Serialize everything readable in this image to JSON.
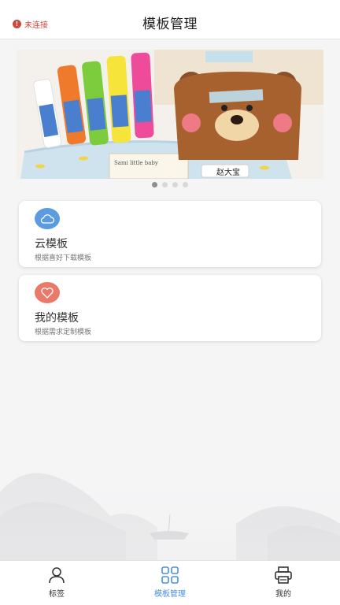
{
  "header": {
    "connection_status": "未连接",
    "status_icon": "!",
    "title": "模板管理"
  },
  "banner": {
    "image_text": {
      "name_tag": "赵大宝",
      "box_label": "Sami little baby"
    },
    "indicator_count": 4,
    "active_index": 0
  },
  "cards": [
    {
      "title": "云模板",
      "subtitle": "根据喜好下载模板",
      "icon": "cloud-icon",
      "color": "#5b9be0"
    },
    {
      "title": "我的模板",
      "subtitle": "根据需求定制模板",
      "icon": "heart-icon",
      "color": "#e97a6a"
    }
  ],
  "tabbar": {
    "items": [
      {
        "label": "标签",
        "icon": "person-icon",
        "active": false
      },
      {
        "label": "模板管理",
        "icon": "grid-icon",
        "active": true
      },
      {
        "label": "我的",
        "icon": "printer-icon",
        "active": false
      }
    ],
    "active_color": "#4a90e2"
  }
}
